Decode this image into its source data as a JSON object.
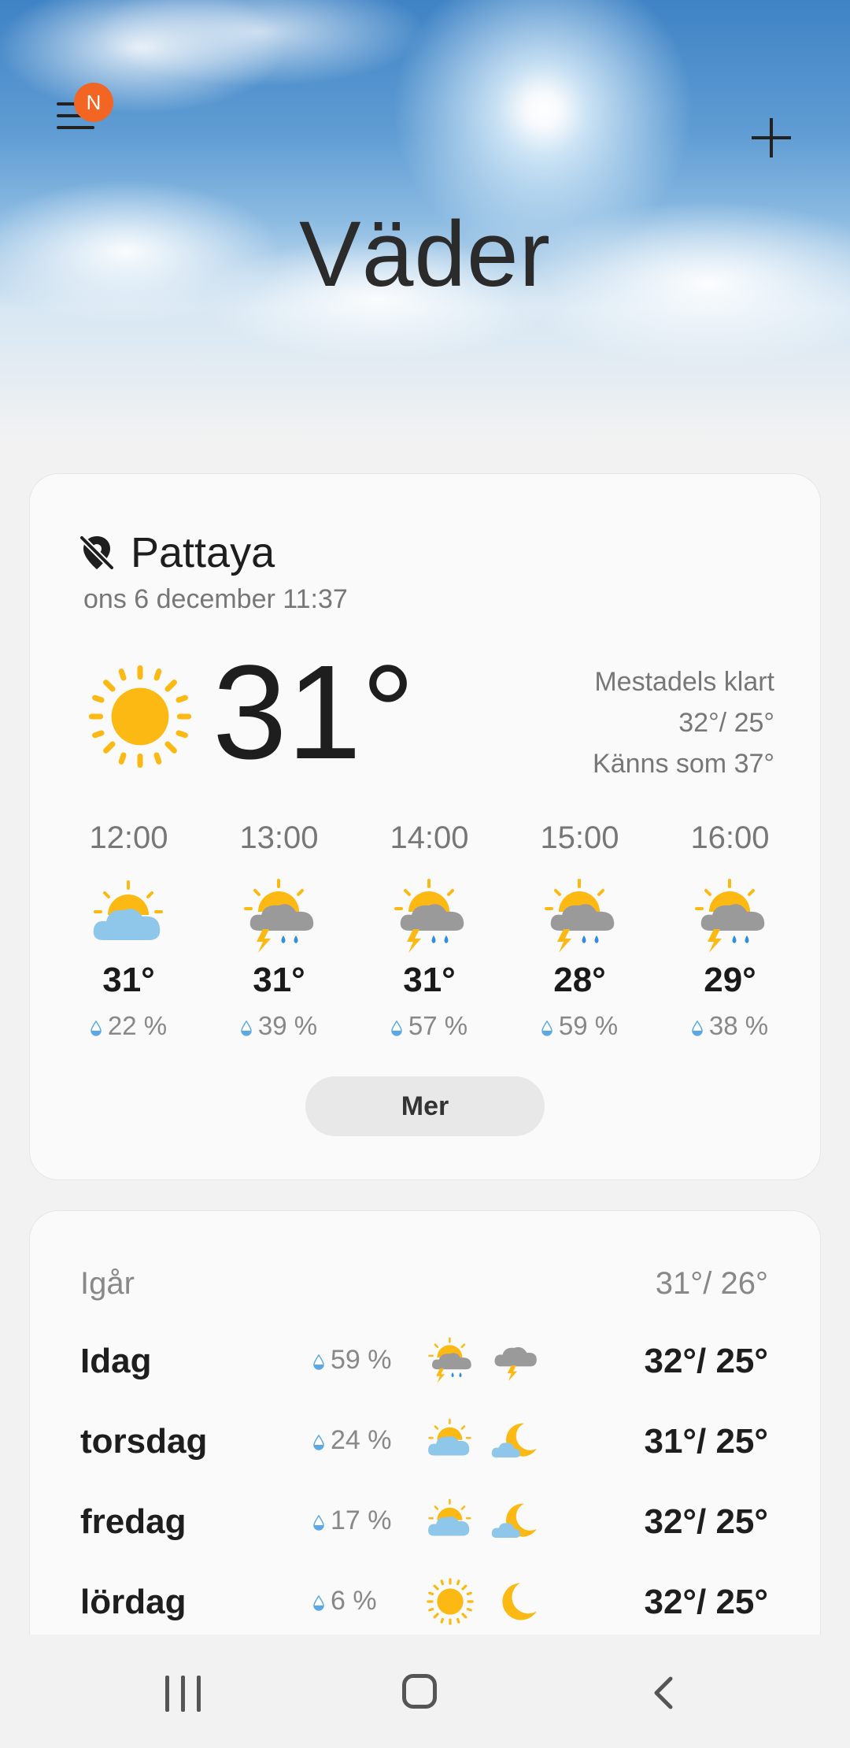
{
  "header": {
    "title": "Väder",
    "menu_badge": "N"
  },
  "current": {
    "location": "Pattaya",
    "datetime": "ons 6 december 11:37",
    "temperature": "31°",
    "condition": "Mestadels klart",
    "high_low": "32°/ 25°",
    "feels_like": "Känns som 37°"
  },
  "hourly": [
    {
      "time": "12:00",
      "temp": "31°",
      "precip": "22 %",
      "icon": "partly-cloudy-icon"
    },
    {
      "time": "13:00",
      "temp": "31°",
      "precip": "39 %",
      "icon": "thunderstorm-rain-icon"
    },
    {
      "time": "14:00",
      "temp": "31°",
      "precip": "57 %",
      "icon": "thunderstorm-rain-icon"
    },
    {
      "time": "15:00",
      "temp": "28°",
      "precip": "59 %",
      "icon": "thunderstorm-rain-icon"
    },
    {
      "time": "16:00",
      "temp": "29°",
      "precip": "38 %",
      "icon": "thunderstorm-rain-icon"
    }
  ],
  "more_button": "Mer",
  "daily": {
    "yesterday_label": "Igår",
    "yesterday_temps": "31°/ 26°",
    "days": [
      {
        "name": "Idag",
        "precip": "59 %",
        "day_icon": "thunderstorm-rain-icon",
        "night_icon": "thunder-cloud-icon",
        "temps": "32°/ 25°"
      },
      {
        "name": "torsdag",
        "precip": "24 %",
        "day_icon": "partly-cloudy-icon",
        "night_icon": "cloudy-night-icon",
        "temps": "31°/ 25°"
      },
      {
        "name": "fredag",
        "precip": "17 %",
        "day_icon": "partly-cloudy-icon",
        "night_icon": "cloudy-night-icon",
        "temps": "32°/ 25°"
      },
      {
        "name": "lördag",
        "precip": "6 %",
        "day_icon": "sun-icon",
        "night_icon": "moon-icon",
        "temps": "32°/ 25°"
      }
    ]
  },
  "colors": {
    "badge": "#f26522",
    "sun": "#fdb913",
    "cloud_blue": "#8ec7ea",
    "rain_blue": "#2f8fde"
  }
}
